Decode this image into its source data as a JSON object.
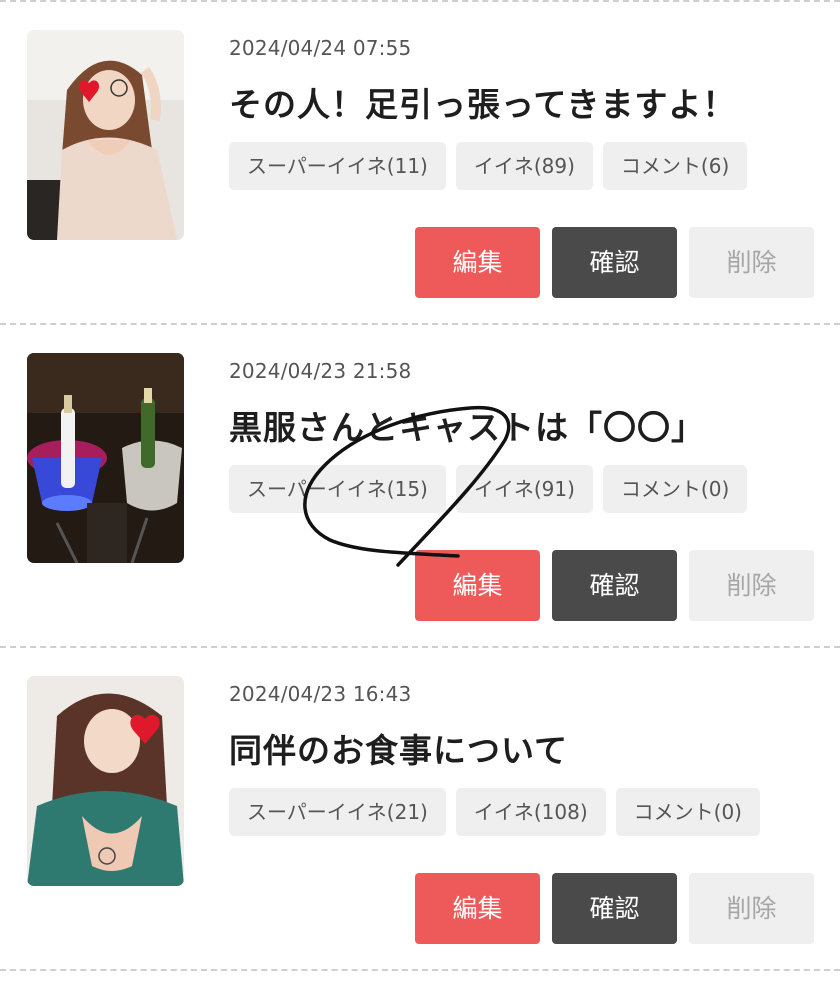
{
  "colors": {
    "edit_button": "#ee5a5a",
    "confirm_button": "#4a4a4a",
    "delete_button": "#efefef",
    "chip_background": "#efefef"
  },
  "posts": [
    {
      "date": "2024/04/24 07:55",
      "title": "その人！足引っ張ってきますよ！",
      "super_like": "スーパーイイネ(11)",
      "like": "イイネ(89)",
      "comment": "コメント(6)",
      "edit_label": "編集",
      "confirm_label": "確認",
      "delete_label": "削除"
    },
    {
      "date": "2024/04/23 21:58",
      "title": "黒服さんとキャストは「〇〇」",
      "super_like": "スーパーイイネ(15)",
      "like": "イイネ(91)",
      "comment": "コメント(0)",
      "edit_label": "編集",
      "confirm_label": "確認",
      "delete_label": "削除"
    },
    {
      "date": "2024/04/23 16:43",
      "title": "同伴のお食事について",
      "super_like": "スーパーイイネ(21)",
      "like": "イイネ(108)",
      "comment": "コメント(0)",
      "edit_label": "編集",
      "confirm_label": "確認",
      "delete_label": "削除"
    }
  ]
}
